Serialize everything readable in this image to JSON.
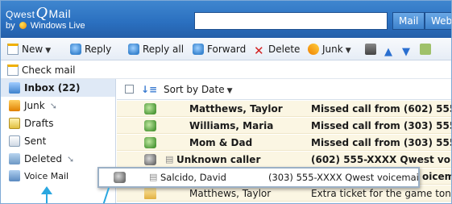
{
  "brand": {
    "line1_a": "Qwest",
    "line1_b": "Mail",
    "line2_a": "by",
    "line2_b": "Windows Live"
  },
  "search": {
    "value": "",
    "placeholder": ""
  },
  "header_buttons": {
    "mail": "Mail",
    "web": "Web"
  },
  "toolbar": {
    "new": "New",
    "reply": "Reply",
    "reply_all": "Reply all",
    "forward": "Forward",
    "delete": "Delete",
    "junk": "Junk"
  },
  "check_mail": "Check mail",
  "sidebar": {
    "items": [
      {
        "label": "Inbox (22)",
        "icon": "inbox-icon"
      },
      {
        "label": "Junk",
        "icon": "junk-folder-icon"
      },
      {
        "label": "Drafts",
        "icon": "drafts-icon"
      },
      {
        "label": "Sent",
        "icon": "sent-icon"
      },
      {
        "label": "Deleted",
        "icon": "deleted-icon"
      },
      {
        "label": "Voice Mail",
        "icon": "voicemail-icon"
      }
    ]
  },
  "sort_label": "Sort by Date",
  "messages": [
    {
      "from": "Matthews, Taylor",
      "subject": "Missed call from (602) 555-XX",
      "icon": "missed-call-icon"
    },
    {
      "from": "Williams, Maria",
      "subject": "Missed call from (303) 555-XX",
      "icon": "missed-call-icon"
    },
    {
      "from": "Mom & Dad",
      "subject": "Missed call from (303) 555-XX",
      "icon": "missed-call-icon"
    },
    {
      "from": "Unknown caller",
      "subject": "(602) 555-XXXX  Qwest voicem",
      "icon": "voicemail-phone-icon"
    },
    {
      "from": "",
      "subject": "oicem",
      "icon": ""
    },
    {
      "from": "Matthews, Taylor",
      "subject": "Extra ticket for the game tonight",
      "icon": "envelope-icon"
    }
  ],
  "popup": {
    "from": "Salcido, David",
    "subject": "(303) 555-XXXX  Qwest voicemail"
  },
  "colors": {
    "header": "#2a6fbf",
    "row_bg": "#fbf6e3",
    "callout": "#2aa7e0"
  }
}
